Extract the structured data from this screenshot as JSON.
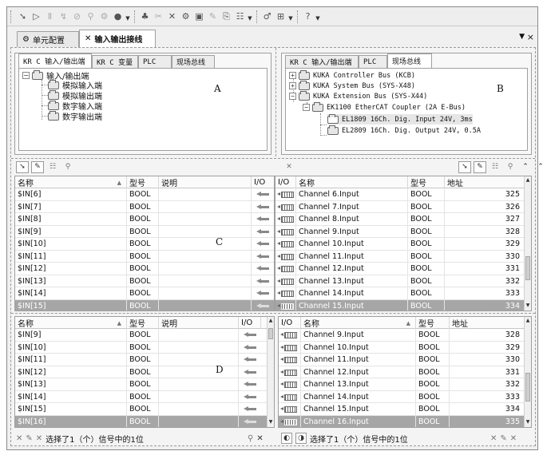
{
  "top_tabs": [
    {
      "label": "单元配置",
      "icon": "cell-config-icon"
    },
    {
      "label": "输入输出接线",
      "icon": "io-wiring-icon"
    }
  ],
  "left_panel": {
    "tabs": [
      "KR C 输入/输出端",
      "KR C 变量",
      "PLC",
      "现场总线"
    ],
    "tree": {
      "root": "输入/输出端",
      "children": [
        "模拟输入端",
        "模拟输出端",
        "数字输入端",
        "数字输出端"
      ]
    },
    "region_label": "A"
  },
  "right_panel": {
    "tabs": [
      "KR C 输入/输出端",
      "PLC",
      "现场总线"
    ],
    "tree": {
      "items": [
        "KUKA Controller Bus (KCB)",
        "KUKA System Bus (SYS-X48)",
        "KUKA Extension Bus (SYS-X44)",
        "EK1100 EtherCAT Coupler (2A E-Bus)",
        "EL1809 16Ch. Dig. Input 24V, 3ms",
        "EL2809 16Ch. Dig. Output 24V, 0.5A"
      ]
    },
    "region_label": "B"
  },
  "grid_c": {
    "region_label": "C",
    "left_headers": {
      "name": "名称",
      "type": "型号",
      "desc": "说明",
      "io": "I/O"
    },
    "right_headers": {
      "io": "I/O",
      "name": "名称",
      "type": "型号",
      "addr": "地址"
    },
    "left_rows": [
      {
        "name": "$IN[6]",
        "type": "BOOL"
      },
      {
        "name": "$IN[7]",
        "type": "BOOL"
      },
      {
        "name": "$IN[8]",
        "type": "BOOL"
      },
      {
        "name": "$IN[9]",
        "type": "BOOL"
      },
      {
        "name": "$IN[10]",
        "type": "BOOL"
      },
      {
        "name": "$IN[11]",
        "type": "BOOL"
      },
      {
        "name": "$IN[12]",
        "type": "BOOL"
      },
      {
        "name": "$IN[13]",
        "type": "BOOL"
      },
      {
        "name": "$IN[14]",
        "type": "BOOL"
      },
      {
        "name": "$IN[15]",
        "type": "BOOL"
      }
    ],
    "right_rows": [
      {
        "name": "Channel 6.Input",
        "type": "BOOL",
        "addr": "325"
      },
      {
        "name": "Channel 7.Input",
        "type": "BOOL",
        "addr": "326"
      },
      {
        "name": "Channel 8.Input",
        "type": "BOOL",
        "addr": "327"
      },
      {
        "name": "Channel 9.Input",
        "type": "BOOL",
        "addr": "328"
      },
      {
        "name": "Channel 10.Input",
        "type": "BOOL",
        "addr": "329"
      },
      {
        "name": "Channel 11.Input",
        "type": "BOOL",
        "addr": "330"
      },
      {
        "name": "Channel 12.Input",
        "type": "BOOL",
        "addr": "331"
      },
      {
        "name": "Channel 13.Input",
        "type": "BOOL",
        "addr": "332"
      },
      {
        "name": "Channel 14.Input",
        "type": "BOOL",
        "addr": "333"
      },
      {
        "name": "Channel 15.Input",
        "type": "BOOL",
        "addr": "334"
      }
    ],
    "selected_row": 9
  },
  "grid_d": {
    "region_label": "D",
    "left_headers": {
      "name": "名称",
      "type": "型号",
      "desc": "说明",
      "io": "I/O"
    },
    "right_headers": {
      "io": "I/O",
      "name": "名称",
      "type": "型号",
      "addr": "地址"
    },
    "left_rows": [
      {
        "name": "$IN[9]",
        "type": "BOOL"
      },
      {
        "name": "$IN[10]",
        "type": "BOOL"
      },
      {
        "name": "$IN[11]",
        "type": "BOOL"
      },
      {
        "name": "$IN[12]",
        "type": "BOOL"
      },
      {
        "name": "$IN[13]",
        "type": "BOOL"
      },
      {
        "name": "$IN[14]",
        "type": "BOOL"
      },
      {
        "name": "$IN[15]",
        "type": "BOOL"
      },
      {
        "name": "$IN[16]",
        "type": "BOOL"
      }
    ],
    "right_rows": [
      {
        "name": "Channel 9.Input",
        "type": "BOOL",
        "addr": "328"
      },
      {
        "name": "Channel 10.Input",
        "type": "BOOL",
        "addr": "329"
      },
      {
        "name": "Channel 11.Input",
        "type": "BOOL",
        "addr": "330"
      },
      {
        "name": "Channel 12.Input",
        "type": "BOOL",
        "addr": "331"
      },
      {
        "name": "Channel 13.Input",
        "type": "BOOL",
        "addr": "332"
      },
      {
        "name": "Channel 14.Input",
        "type": "BOOL",
        "addr": "333"
      },
      {
        "name": "Channel 15.Input",
        "type": "BOOL",
        "addr": "334"
      },
      {
        "name": "Channel 16.Input",
        "type": "BOOL",
        "addr": "335"
      }
    ],
    "selected_row": 7
  },
  "status": {
    "left": "选择了1（个）信号中的1位",
    "right": "选择了1（个）信号中的1位"
  },
  "colors": {
    "selection": "#a6a6a6",
    "border": "#a0a0a0"
  }
}
